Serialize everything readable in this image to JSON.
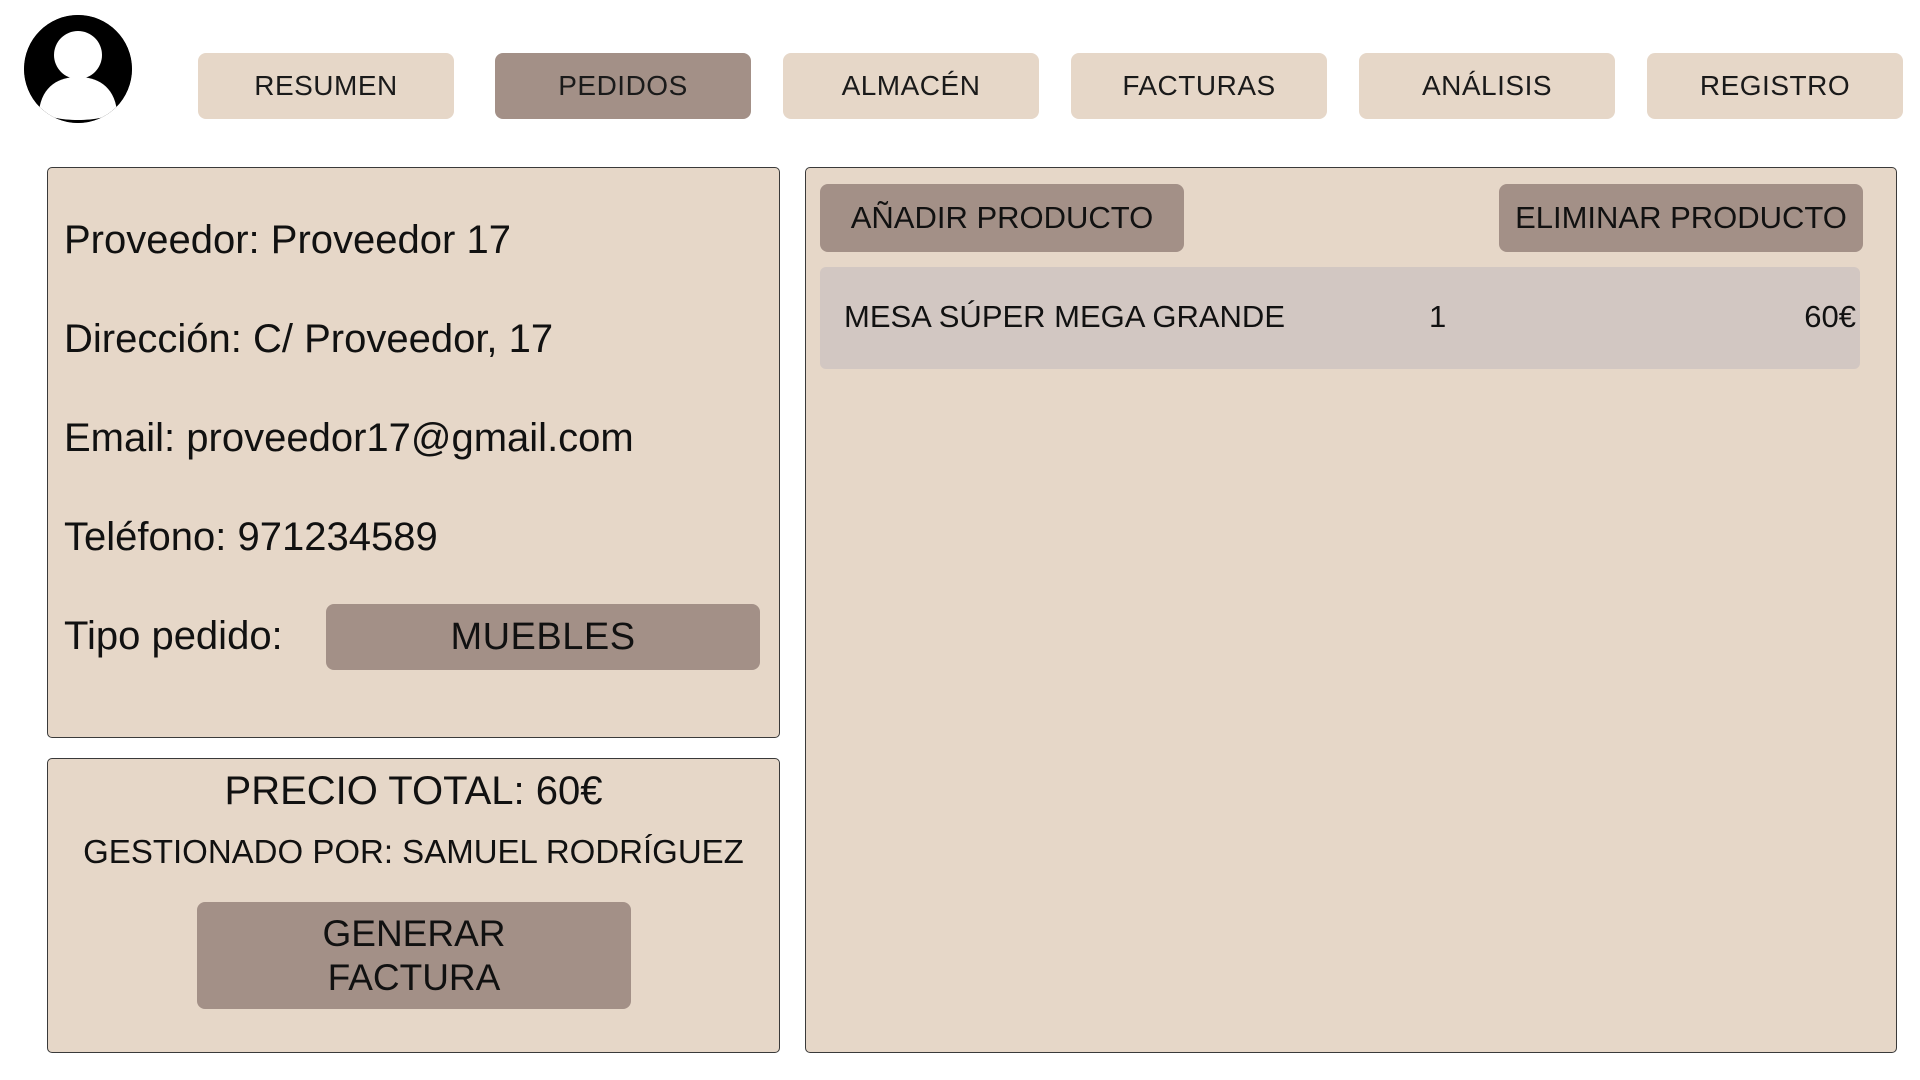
{
  "nav": {
    "tabs": [
      {
        "label": "RESUMEN"
      },
      {
        "label": "PEDIDOS"
      },
      {
        "label": "ALMACÉN"
      },
      {
        "label": "FACTURAS"
      },
      {
        "label": "ANÁLISIS"
      },
      {
        "label": "REGISTRO"
      }
    ],
    "active_tab": "PEDIDOS"
  },
  "supplier": {
    "provider_label": "Proveedor:",
    "provider_value": "Proveedor 17",
    "address_label": "Dirección:",
    "address_value": "C/ Proveedor, 17",
    "email_label": "Email:",
    "email_value": "proveedor17@gmail.com",
    "phone_label": "Teléfono:",
    "phone_value": "971234589",
    "order_type_label": "Tipo pedido:",
    "order_type_value": "MUEBLES"
  },
  "summary": {
    "total_text": "PRECIO TOTAL: 60€",
    "managed_by_text": "GESTIONADO POR: SAMUEL RODRÍGUEZ",
    "generate_line1": "GENERAR",
    "generate_line2": "FACTURA"
  },
  "products": {
    "add_label": "AÑADIR PRODUCTO",
    "remove_label": "ELIMINAR PRODUCTO",
    "rows": [
      {
        "name": "MESA SÚPER MEGA GRANDE",
        "quantity": "1",
        "price": "60€"
      }
    ]
  },
  "colors": {
    "panel_bg": "#e6d7c8",
    "button_bg": "#a39087",
    "row_bg": "#d2c7c2"
  },
  "icons": {
    "avatar": "user-avatar-icon"
  }
}
